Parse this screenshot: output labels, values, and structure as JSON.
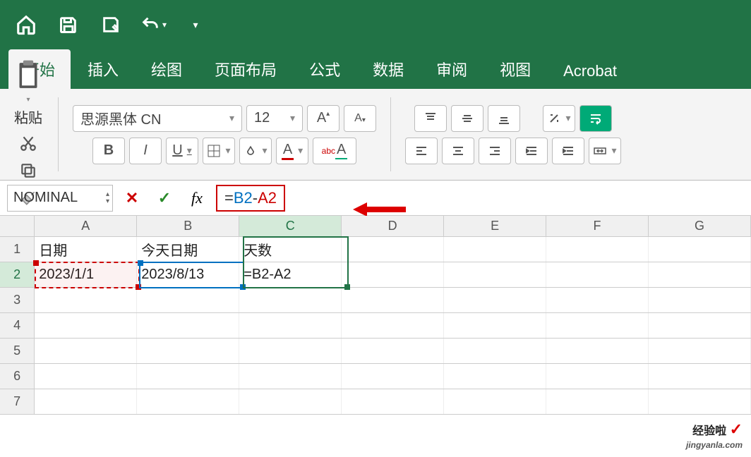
{
  "quickaccess": {
    "icons": [
      "home-icon",
      "save-icon",
      "draw-icon",
      "undo-icon",
      "customize-icon"
    ]
  },
  "tabs": [
    "开始",
    "插入",
    "绘图",
    "页面布局",
    "公式",
    "数据",
    "审阅",
    "视图",
    "Acrobat"
  ],
  "active_tab": "开始",
  "ribbon": {
    "paste_label": "粘贴",
    "font_name": "思源黑体 CN",
    "font_size": "12",
    "bold": "B",
    "italic": "I",
    "underline": "U",
    "inc_font": "A",
    "dec_font": "A",
    "fontcolor": "A",
    "phonetic": "abc"
  },
  "namebox": "NOMINAL",
  "formula_bar": {
    "fx": "fx",
    "eq": "=",
    "ref_b": "B2",
    "op": "-",
    "ref_a": "A2"
  },
  "columns": [
    "A",
    "B",
    "C",
    "D",
    "E",
    "F",
    "G"
  ],
  "rows": [
    "1",
    "2",
    "3",
    "4",
    "5",
    "6",
    "7"
  ],
  "cells": {
    "A1": "日期",
    "B1": "今天日期",
    "C1": "天数",
    "A2": "2023/1/1",
    "B2": "2023/8/13",
    "C2": "=B2-A2"
  },
  "watermark": {
    "text": "经验啦",
    "check": "✓",
    "url": "jingyanla.com"
  }
}
